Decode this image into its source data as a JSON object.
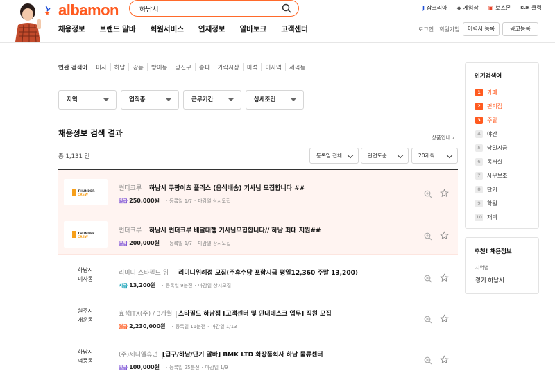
{
  "header": {
    "logo": "albamon",
    "search_value": "하남시",
    "gnb": [
      "채용정보",
      "브랜드 알바",
      "회원서비스",
      "인재정보",
      "알바토크",
      "고객센터"
    ],
    "family": [
      {
        "mark": "J",
        "label": "잡코리아",
        "color": "#1d4fd8"
      },
      {
        "mark": "◆",
        "label": "게임잡",
        "color": "#555555"
      },
      {
        "mark": "▣",
        "label": "보스몬",
        "color": "#e8442a"
      },
      {
        "mark": "KLIK",
        "label": "클릭",
        "color": "#333333"
      }
    ],
    "login": "로그인",
    "join": "회원가입",
    "resume_btn": "이력서 등록",
    "post_btn": "공고등록"
  },
  "related": {
    "label": "연관 검색어",
    "keywords": [
      "미사",
      "하남",
      "강동",
      "방이동",
      "광진구",
      "송파",
      "가락시장",
      "마석",
      "미사역",
      "세곡동"
    ]
  },
  "filters": [
    "지역",
    "업직종",
    "근무기간",
    "상세조건"
  ],
  "results": {
    "title": "채용정보 검색 결과",
    "notice": "상품안내",
    "count": "총 1,131 건",
    "sort": [
      "등록일 전체",
      "관련도순",
      "20개씩"
    ]
  },
  "jobs": [
    {
      "type": "ad",
      "company": "썬더크루",
      "title": "하남시 쿠팡이츠 플러스 (음식배송) 기사님 모집합니다 ##",
      "pay_type": "일급",
      "pay_color": "#7a4fd6",
      "pay": "250,000원",
      "posted": "등록일 1/7",
      "deadline": "마감일 상시모집"
    },
    {
      "type": "ad",
      "company": "썬더크루",
      "title": "하남시 썬더크루 배달대행 기사님모집합니다// 하남 최대 지원##",
      "pay_type": "일급",
      "pay_color": "#7a4fd6",
      "pay": "200,000원",
      "posted": "등록일 1/7",
      "deadline": "마감일 상시모집"
    },
    {
      "type": "normal",
      "loc1": "하남시",
      "loc2": "미사동",
      "company": "리미니 스타필드 위",
      "title": "리미니위례점 모집(주휴수당 포함시급 평일12,360 주말 13,200)",
      "pay_type": "시급",
      "pay_color": "#17a2b8",
      "pay": "13,200원",
      "posted": "등록일 9분전",
      "deadline": "마감일 상시모집"
    },
    {
      "type": "normal",
      "loc1": "원주시",
      "loc2": "개운동",
      "company": "효성ITX(주) / 3개월",
      "title": "스타필드 하남점 [고객센터 및 안내데스크 업무] 직원 모집",
      "pay_type": "월급",
      "pay_color": "#ff5a1f",
      "pay": "2,230,000원",
      "posted": "등록일 11분전",
      "deadline": "마감일 1/13"
    },
    {
      "type": "normal",
      "loc1": "하남시",
      "loc2": "덕풍동",
      "company": "(주)제니엘휴먼",
      "title": "[급구/하남/단기 알바] BMK LTD 화장품회사 하남 물류센터",
      "pay_type": "일급",
      "pay_color": "#7a4fd6",
      "pay": "100,000원",
      "posted": "등록일 25분전",
      "deadline": "마감일 1/9"
    }
  ],
  "popular": {
    "title": "인기검색어",
    "items": [
      {
        "rank": "1",
        "word": "카페"
      },
      {
        "rank": "2",
        "word": "편의점"
      },
      {
        "rank": "3",
        "word": "주말"
      },
      {
        "rank": "4",
        "word": "야간"
      },
      {
        "rank": "5",
        "word": "당일지급"
      },
      {
        "rank": "6",
        "word": "독서실"
      },
      {
        "rank": "7",
        "word": "사무보조"
      },
      {
        "rank": "8",
        "word": "단기"
      },
      {
        "rank": "9",
        "word": "학원"
      },
      {
        "rank": "10",
        "word": "재택"
      }
    ]
  },
  "recommend": {
    "title": "추천! 채용정보",
    "label": "지역별",
    "value": "경기 하남시"
  },
  "colors": {
    "accent": "#ff5a1f",
    "ad_bg": "#fff4f1"
  }
}
